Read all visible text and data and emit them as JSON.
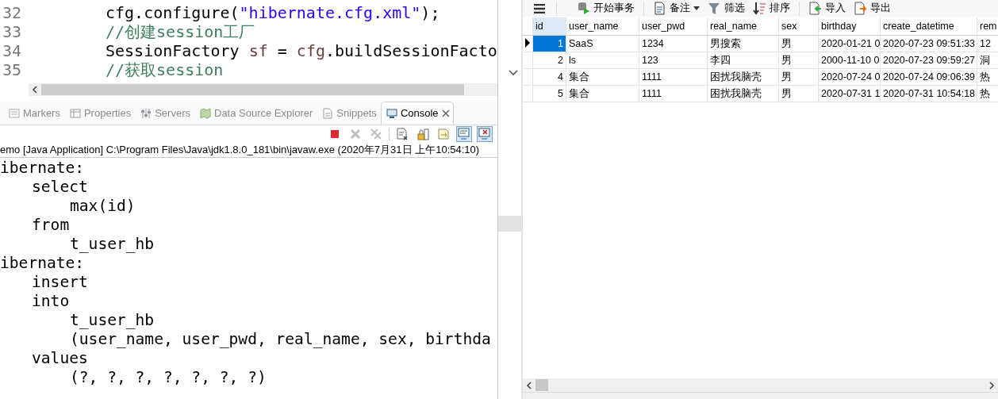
{
  "editor": {
    "lines": [
      {
        "number": "32",
        "tokens": [
          {
            "kind": "plain",
            "text": "cfg.configure("
          },
          {
            "kind": "string",
            "text": "\"hibernate.cfg.xml\""
          },
          {
            "kind": "plain",
            "text": ");"
          }
        ]
      },
      {
        "number": "33",
        "tokens": [
          {
            "kind": "comment",
            "text": "//创建session工厂"
          }
        ]
      },
      {
        "number": "34",
        "tokens": [
          {
            "kind": "plain",
            "text": "SessionFactory "
          },
          {
            "kind": "var",
            "text": "sf"
          },
          {
            "kind": "plain",
            "text": " = "
          },
          {
            "kind": "var",
            "text": "cfg"
          },
          {
            "kind": "plain",
            "text": ".buildSessionFacto"
          }
        ]
      },
      {
        "number": "35",
        "tokens": [
          {
            "kind": "comment",
            "text": "//获取session"
          }
        ]
      }
    ]
  },
  "views": {
    "tabs": [
      {
        "label": "Markers",
        "kind": "markers",
        "selected": false
      },
      {
        "label": "Properties",
        "kind": "properties",
        "selected": false
      },
      {
        "label": "Servers",
        "kind": "servers",
        "selected": false
      },
      {
        "label": "Data Source Explorer",
        "kind": "datasource",
        "selected": false
      },
      {
        "label": "Snippets",
        "kind": "snippets",
        "selected": false
      },
      {
        "label": "Console",
        "kind": "console",
        "selected": true
      }
    ]
  },
  "console": {
    "toolbar": [
      {
        "kind": "terminate",
        "disabled": false,
        "pressed": false
      },
      {
        "kind": "remove",
        "disabled": true,
        "pressed": false
      },
      {
        "kind": "remove-all",
        "disabled": true,
        "pressed": false
      },
      {
        "kind": "clear",
        "disabled": false,
        "pressed": false
      },
      {
        "kind": "lock",
        "disabled": false,
        "pressed": false
      },
      {
        "kind": "word-wrap",
        "disabled": false,
        "pressed": false
      },
      {
        "kind": "show-out",
        "disabled": false,
        "pressed": true
      },
      {
        "kind": "show-err",
        "disabled": false,
        "pressed": true
      }
    ],
    "launch": "emo [Java Application] C:\\Program Files\\Java\\jdk1.8.0_181\\bin\\javaw.exe (2020年7月31日 上午10:54:10)",
    "output": [
      {
        "text": "ibernate:",
        "children": [
          {
            "text": "select",
            "children": [
              {
                "text": "max(id)"
              }
            ]
          },
          {
            "text": "from",
            "children": [
              {
                "text": "t_user_hb"
              }
            ]
          }
        ]
      },
      {
        "text": "ibernate:",
        "children": [
          {
            "text": "insert"
          },
          {
            "text": "into",
            "children": [
              {
                "text": "t_user_hb"
              },
              {
                "text": "(user_name, user_pwd, real_name, sex, birthda"
              }
            ]
          },
          {
            "text": "values",
            "children": [
              {
                "text": "(?, ?, ?, ?, ?, ?, ?)"
              }
            ]
          }
        ]
      }
    ]
  },
  "grid": {
    "toolbar": [
      {
        "kind": "begin",
        "label": "开始事务",
        "dropdown": false
      },
      {
        "kind": "note",
        "label": "备注",
        "dropdown": true
      },
      {
        "kind": "filter",
        "label": "筛选",
        "dropdown": false
      },
      {
        "kind": "sort",
        "label": "排序",
        "dropdown": false
      },
      {
        "kind": "import",
        "label": "导入",
        "dropdown": false
      },
      {
        "kind": "export",
        "label": "导出",
        "dropdown": false
      }
    ],
    "columns": [
      "id",
      "user_name",
      "user_pwd",
      "real_name",
      "sex",
      "birthday",
      "create_datetime",
      "rem"
    ],
    "rows": [
      {
        "selected": true,
        "cells": [
          "1",
          "SaaS",
          "1234",
          "男搜索",
          "男",
          "2020-01-21 0",
          "2020-07-23 09:51:33",
          "12"
        ]
      },
      {
        "selected": false,
        "cells": [
          "2",
          "ls",
          "123",
          "李四",
          "男",
          "2000-11-10 0",
          "2020-07-23 09:59:27",
          "洞"
        ]
      },
      {
        "selected": false,
        "cells": [
          "4",
          "集合",
          "1111",
          "困扰我脑壳",
          "男",
          "2020-07-24 0",
          "2020-07-24 09:06:39",
          "热"
        ]
      },
      {
        "selected": false,
        "cells": [
          "5",
          "集合",
          "1111",
          "困扰我脑壳",
          "男",
          "2020-07-31 1",
          "2020-07-31 10:54:18",
          "热"
        ]
      }
    ]
  }
}
